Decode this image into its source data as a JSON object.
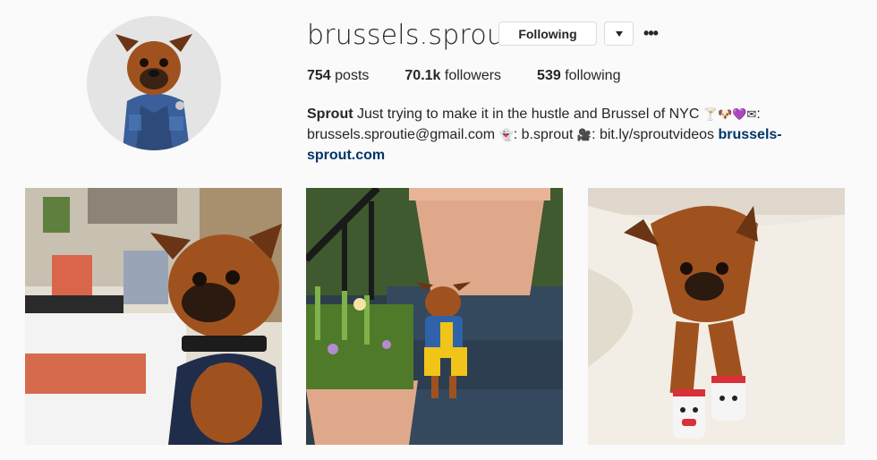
{
  "profile": {
    "username": "brussels.sprout",
    "follow_label": "Following",
    "dropdown_icon": "caret-down-icon",
    "more_label": "•••",
    "stats": {
      "posts_count": "754",
      "posts_label": "posts",
      "followers_count": "70.1k",
      "followers_label": "followers",
      "following_count": "539",
      "following_label": "following"
    },
    "bio": {
      "name": "Sprout",
      "line1": "Just trying to make it in the hustle and Brussel of NYC",
      "line1_emojis": "🍸🐶💜",
      "email_emoji": "✉",
      "email_sep": ":",
      "email": "brussels.sproutie@gmail.com",
      "snap_emoji": "👻",
      "snap": ": b.sprout",
      "video_emoji": "🎥",
      "videos": ": bit.ly/sproutvideos",
      "website": "brussels-sprout.com"
    }
  },
  "posts": [
    {
      "icon": "photo-dog-restaurant"
    },
    {
      "icon": "photo-dog-steps-flowers"
    },
    {
      "icon": "photo-dog-socks"
    }
  ],
  "colors": {
    "link": "#003569",
    "border": "#dbdbdb",
    "background": "#fafafa",
    "fur": "#a0521e"
  }
}
